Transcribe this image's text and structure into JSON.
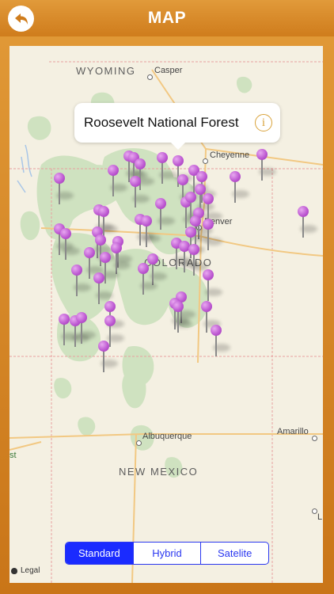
{
  "header": {
    "title": "MAP",
    "back_icon": "back-arrow-icon",
    "background_color": "#d98a2a"
  },
  "map": {
    "state_labels": [
      "WYOMING",
      "COLORADO",
      "NEW MEXICO"
    ],
    "cities": [
      {
        "name": "Casper"
      },
      {
        "name": "Cheyenne"
      },
      {
        "name": "Denver"
      },
      {
        "name": "Albuquerque"
      },
      {
        "name": "Amarillo"
      }
    ],
    "edge_labels": [
      "st",
      "L"
    ],
    "pin_color": "#bb55d0",
    "pin_count": 60
  },
  "callout": {
    "title": "Roosevelt National Forest",
    "info_icon": "info-icon"
  },
  "map_type_control": {
    "segments": [
      "Standard",
      "Hybrid",
      "Satelite"
    ],
    "selected": "Standard",
    "accent_color": "#1a2bff"
  },
  "legal": {
    "label": "Legal"
  }
}
